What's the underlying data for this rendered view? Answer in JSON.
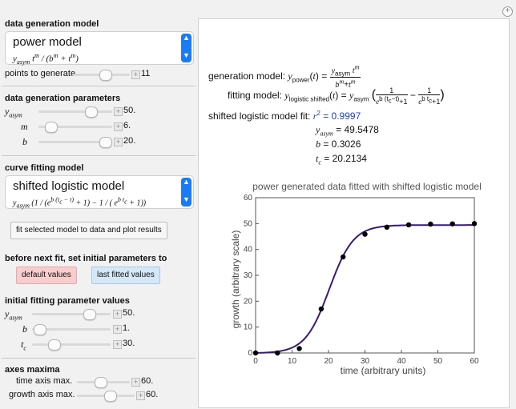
{
  "left": {
    "gen_model": {
      "title": "data generation model",
      "selected": "power model",
      "formula": "yasym tm / (bm + tm)",
      "formula_parts": {
        "y": "y",
        "y_sub": "asym",
        "t1": "t",
        "m1": "m",
        "b": "b",
        "m2": "m",
        "t2": "t",
        "m3": "m"
      }
    },
    "points": {
      "label": "points to generate",
      "value": "11",
      "fraction": 0.55
    },
    "gen_params": {
      "title": "data generation parameters",
      "yasym": {
        "label_base": "y",
        "label_sub": "asym",
        "value": "50.",
        "fraction": 0.8
      },
      "m": {
        "label": "m",
        "value": "6.",
        "fraction": 0.2
      },
      "b": {
        "label": "b",
        "value": "20.",
        "fraction": 0.95
      }
    },
    "fit_model": {
      "title": "curve fitting model",
      "selected": "shifted logistic model",
      "formula": "yasym (1 / (eb (tc − t) + 1) − 1 / ( eb tc + 1))"
    },
    "fit_button": "fit selected model to data and plot results",
    "before_fit": {
      "title": "before next fit, set initial parameters to",
      "default_btn": "default values",
      "last_btn": "last fitted values"
    },
    "init_params": {
      "title": "initial fitting parameter values",
      "yasym": {
        "label_base": "y",
        "label_sub": "asym",
        "value": "50.",
        "fraction": 0.8
      },
      "b": {
        "label": "b",
        "value": "1.",
        "fraction": 0.03
      },
      "tc": {
        "label_base": "t",
        "label_sub": "c",
        "value": "30.",
        "fraction": 0.2
      }
    },
    "axes": {
      "title": "axes maxima",
      "time": {
        "label": "time axis max.",
        "value": "60.",
        "fraction": 0.45
      },
      "growth": {
        "label": "growth axis max.",
        "value": "60.",
        "fraction": 0.45
      }
    }
  },
  "right": {
    "gen_label": "generation model:",
    "fit_label": "fitting model:",
    "fit_result_label": "shifted logistic model fit:",
    "r2_text": "r",
    "r2_sup": "2",
    "r2_value": "= 0.9997",
    "yasym_fit": "= 49.5478",
    "b_fit": "= 0.3026",
    "tc_fit": "= 20.2134",
    "eq": {
      "y": "y",
      "power": "power",
      "t": "(t) =",
      "yasym_num": "asym",
      "m": "m",
      "bm": "b",
      "plus": "+t",
      "logistic": "logistic shifted",
      "t2": "(t) =",
      "asym2": "asym",
      "one": "1",
      "minus": "−",
      "e": "e",
      "b_in": "b",
      "tc_t": "(tc−t)",
      "plus1": "+1",
      "tc": "tc",
      "asym_lbl": "asym",
      "b_lbl": "b",
      "t_lbl": "t",
      "c_lbl": "c"
    }
  },
  "chart_data": {
    "type": "scatter",
    "title": "power generated data fitted with shifted logistic model",
    "xlabel": "time (arbitrary units)",
    "ylabel": "growth (arbitrary scale)",
    "xlim": [
      0,
      60
    ],
    "ylim": [
      0,
      60
    ],
    "xticks": [
      0,
      10,
      20,
      30,
      40,
      50,
      60
    ],
    "yticks": [
      0,
      10,
      20,
      30,
      40,
      50,
      60
    ],
    "points": {
      "x": [
        0,
        6,
        12,
        18,
        24,
        30,
        36,
        42,
        48,
        54,
        60
      ],
      "y": [
        0,
        0.0,
        1.7,
        17.0,
        37.1,
        45.9,
        48.6,
        49.5,
        49.8,
        49.9,
        50.0
      ]
    },
    "fit": {
      "yasym": 49.5478,
      "b": 0.3026,
      "tc": 20.2134
    },
    "colors": {
      "curve": "#3a1a78",
      "points": "#000000"
    }
  }
}
